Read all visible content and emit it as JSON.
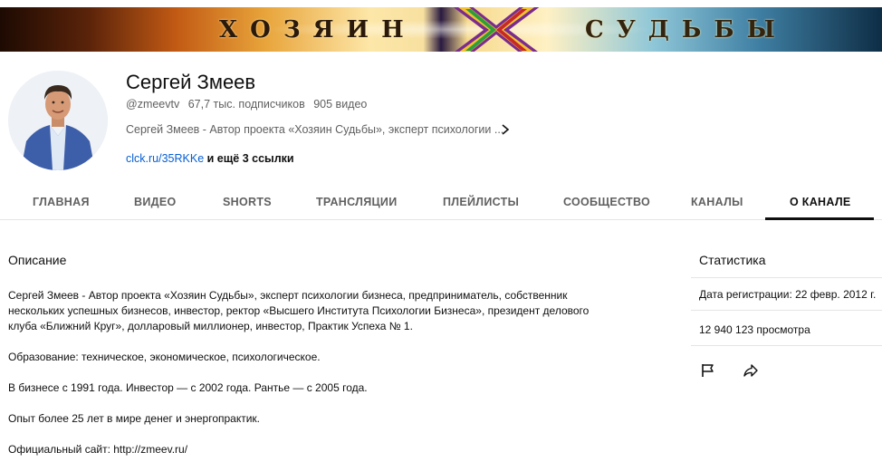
{
  "banner": {
    "text_left": "ХОЗЯИН",
    "text_right": "СУДЬБЫ"
  },
  "channel": {
    "name": "Сергей Змеев",
    "handle": "@zmeevtv",
    "subscribers": "67,7 тыс. подписчиков",
    "videos": "905 видео",
    "short_description": "Сергей Змеев - Автор проекта «Хозяин Судьбы», эксперт психологии ...",
    "link": "clck.ru/35RKKe",
    "more_links": "и ещё 3 ссылки"
  },
  "tabs": [
    {
      "label": "ГЛАВНАЯ"
    },
    {
      "label": "ВИДЕО"
    },
    {
      "label": "SHORTS"
    },
    {
      "label": "ТРАНСЛЯЦИИ"
    },
    {
      "label": "ПЛЕЙЛИСТЫ"
    },
    {
      "label": "СООБЩЕСТВО"
    },
    {
      "label": "КАНАЛЫ"
    },
    {
      "label": "О КАНАЛЕ"
    }
  ],
  "about": {
    "title": "Описание",
    "paragraphs": [
      "Сергей Змеев - Автор проекта «Хозяин Судьбы», эксперт психологии бизнеса, предприниматель, собственник",
      "нескольких успешных бизнесов, инвестор, ректор «Высшего Института Психологии Бизнеса», президент делового",
      "клуба «Ближний Круг», долларовый миллионер, инвестор, Практик Успеха № 1.",
      "Образование: техническое, экономическое, психологическое.",
      "В бизнесе с 1991 года. Инвестор — с 2002 года. Рантье — с 2005 года.",
      "Опыт более 25 лет в мире денег и энергопрактик.",
      "Официальный сайт: http://zmeev.ru/"
    ]
  },
  "stats": {
    "title": "Статистика",
    "joined": "Дата регистрации: 22 февр. 2012 г.",
    "views": "12 940 123 просмотра"
  },
  "colors": {
    "link": "#065fd4",
    "text_primary": "#0f0f0f",
    "text_secondary": "#606060",
    "divider": "#e5e5e5"
  },
  "icons": [
    "chevron-right-icon",
    "flag-icon",
    "share-icon"
  ]
}
